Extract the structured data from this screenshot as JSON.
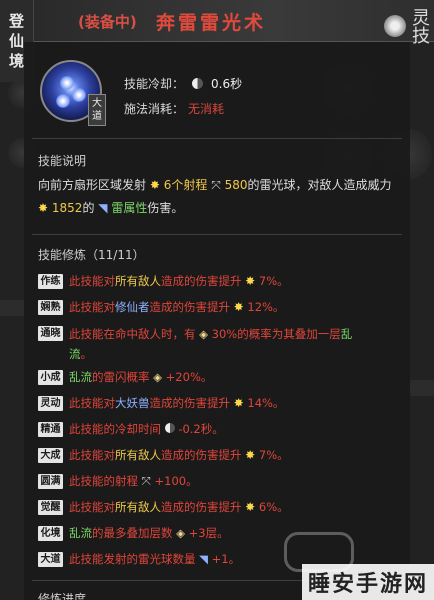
{
  "side_tab": {
    "chars": [
      "登",
      "仙",
      "境"
    ]
  },
  "header": {
    "equipped": "(装备中)",
    "skill_name": "奔雷雷光术",
    "logo_text": "灵技"
  },
  "skill": {
    "grade": "大道",
    "cooldown_label": "技能冷却：",
    "cooldown_value": "0.6秒",
    "cost_label": "施法消耗：",
    "cost_value": "无消耗"
  },
  "description": {
    "title": "技能说明",
    "line1_a": "向前方扇形区域发射",
    "line1_b": "6个射程",
    "line1_c": "580",
    "line1_d": "的雷光球，对敌人造成威力",
    "line2_a": "1852",
    "line2_b": "的",
    "line2_c": "雷属性",
    "line2_d": "伤害。"
  },
  "mods": {
    "title": "技能修炼（11/11）",
    "rows": [
      {
        "tag": "作练",
        "a": "此技能对",
        "b": "所有敌人",
        "c": "造成的伤害提升",
        "d": "7%。"
      },
      {
        "tag": "娴熟",
        "a": "此技能对",
        "b": "修仙者",
        "c": "造成的伤害提升",
        "d": "12%。"
      },
      {
        "tag": "通晓",
        "a": "此技能在命中敌人时，有",
        "b": "30%的概率为其叠加一层",
        "c": "乱",
        "d": "流",
        "e": "。"
      },
      {
        "tag": "小成",
        "a": "乱流",
        "b": "的雷闪概率",
        "c": "+20%。"
      },
      {
        "tag": "灵动",
        "a": "此技能对",
        "b": "大妖兽",
        "c": "造成的伤害提升",
        "d": "14%。"
      },
      {
        "tag": "精通",
        "a": "此技能的冷却时间",
        "b": "-0.2秒。"
      },
      {
        "tag": "大成",
        "a": "此技能对",
        "b": "所有敌人",
        "c": "造成的伤害提升",
        "d": "7%。"
      },
      {
        "tag": "圆满",
        "a": "此技能的射程",
        "b": "+100。"
      },
      {
        "tag": "觉醒",
        "a": "此技能对",
        "b": "所有敌人",
        "c": "造成的伤害提升",
        "d": "6%。"
      },
      {
        "tag": "化境",
        "a": "乱流",
        "b": "的最多叠加层数",
        "c": "+3层。"
      },
      {
        "tag": "大道",
        "a": "此技能发射的雷光球数量",
        "b": "+1。"
      }
    ]
  },
  "progress": {
    "label": "修炼进度"
  },
  "watermark": {
    "text": "睡安手游网"
  }
}
